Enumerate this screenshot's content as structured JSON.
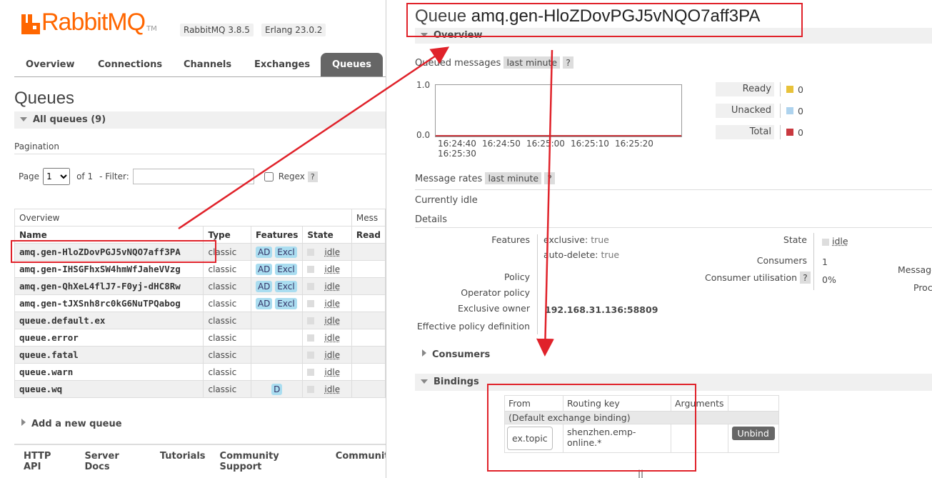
{
  "left": {
    "logo": {
      "text": "RabbitMQ",
      "tm": "TM"
    },
    "version": "RabbitMQ 3.8.5",
    "erlang": "Erlang 23.0.2",
    "tabs": [
      "Overview",
      "Connections",
      "Channels",
      "Exchanges",
      "Queues"
    ],
    "active_tab": "Queues",
    "title": "Queues",
    "all_queues": "All queues (9)",
    "pagination_label": "Pagination",
    "page_label": "Page",
    "page_value": "1",
    "of_label": "of 1",
    "filter_label": "- Filter:",
    "filter_value": "",
    "regex_label": "Regex",
    "help": "?",
    "table": {
      "group_overview": "Overview",
      "group_messages": "Mess",
      "headers": [
        "Name",
        "Type",
        "Features",
        "State",
        "Read"
      ],
      "rows": [
        {
          "name": "amq.gen-HloZDovPGJ5vNQO7aff3PA",
          "type": "classic",
          "f1": "AD",
          "f2": "Excl",
          "state": "idle"
        },
        {
          "name": "amq.gen-IHSGFhxSW4hmWfJaheVVzg",
          "type": "classic",
          "f1": "AD",
          "f2": "Excl",
          "state": "idle"
        },
        {
          "name": "amq.gen-QhXeL4flJ7-F0yj-dHC8Rw",
          "type": "classic",
          "f1": "AD",
          "f2": "Excl",
          "state": "idle"
        },
        {
          "name": "amq.gen-tJXSnh8rc0kG6NuTPQabog",
          "type": "classic",
          "f1": "AD",
          "f2": "Excl",
          "state": "idle"
        },
        {
          "name": "queue.default.ex",
          "type": "classic",
          "f1": "",
          "f2": "",
          "state": "idle"
        },
        {
          "name": "queue.error",
          "type": "classic",
          "f1": "",
          "f2": "",
          "state": "idle"
        },
        {
          "name": "queue.fatal",
          "type": "classic",
          "f1": "",
          "f2": "",
          "state": "idle"
        },
        {
          "name": "queue.warn",
          "type": "classic",
          "f1": "",
          "f2": "",
          "state": "idle"
        },
        {
          "name": "queue.wq",
          "type": "classic",
          "f1": "D",
          "f2": "",
          "state": "idle"
        }
      ]
    },
    "add_queue": "Add a new queue",
    "footer": [
      "HTTP API",
      "Server Docs",
      "Tutorials",
      "Community Support",
      "Community"
    ]
  },
  "right": {
    "title_prefix": "Queue",
    "queue_name": "amq.gen-HloZDovPGJ5vNQO7aff3PA",
    "overview": "Overview",
    "queued_messages": "Queued messages",
    "last_minute": "last minute",
    "help": "?",
    "chart_y_top": "1.0",
    "chart_y_bottom": "0.0",
    "chart_times": [
      "16:24:40",
      "16:24:50",
      "16:25:00",
      "16:25:10",
      "16:25:20",
      "16:25:30"
    ],
    "legend": [
      {
        "label": "Ready",
        "value": "0",
        "color": "#e8c23a"
      },
      {
        "label": "Unacked",
        "value": "0",
        "color": "#aed3ee"
      },
      {
        "label": "Total",
        "value": "0",
        "color": "#c9393f"
      }
    ],
    "message_rates": "Message rates",
    "currently_idle": "Currently idle",
    "details": "Details",
    "features_label": "Features",
    "exclusive_key": "exclusive:",
    "exclusive_val": "true",
    "autodelete_key": "auto-delete:",
    "autodelete_val": "true",
    "policy_label": "Policy",
    "operator_policy_label": "Operator policy",
    "exclusive_owner_label": "Exclusive owner",
    "exclusive_owner_value": "192.168.31.136:58809",
    "effective_policy_label": "Effective policy definition",
    "state_label": "State",
    "state_value": "idle",
    "consumers_label": "Consumers",
    "consumers_value": "1",
    "consumer_util_label": "Consumer utilisation",
    "consumer_util_value": "0%",
    "messages_cut": "Message",
    "proc_cut": "Proc",
    "consumers_section": "Consumers",
    "bindings_section": "Bindings",
    "bind_headers": [
      "From",
      "Routing key",
      "Arguments",
      ""
    ],
    "default_binding": "(Default exchange binding)",
    "bind_from": "ex.topic",
    "bind_key": "shenzhen.emp-online.*",
    "unbind": "Unbind",
    "below_table": "||"
  },
  "colors": {
    "accent": "#ff6600",
    "annotation": "#e0222a"
  }
}
